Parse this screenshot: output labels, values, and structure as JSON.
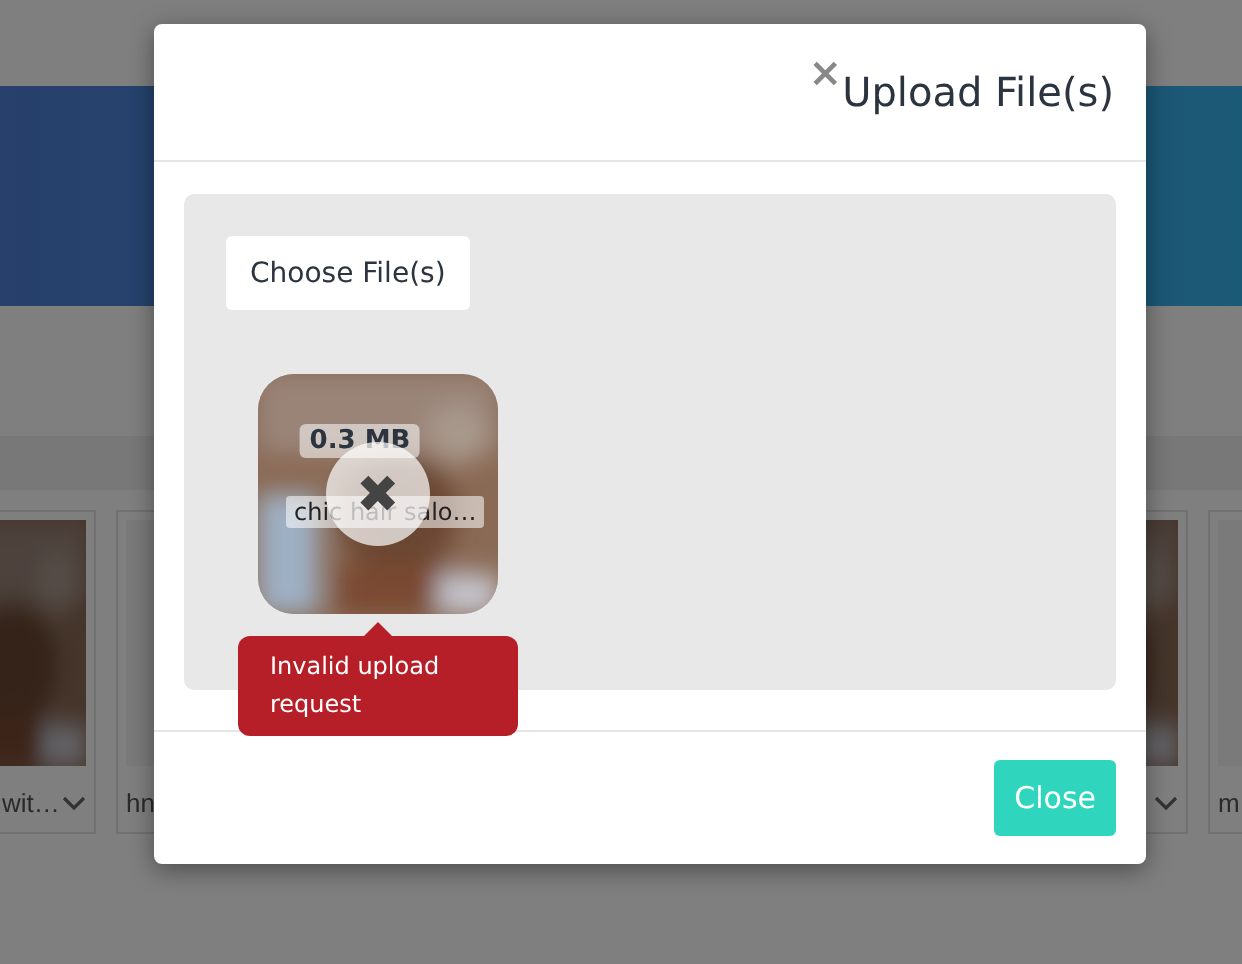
{
  "background_page": {
    "cards": [
      {
        "kind": "picture",
        "caption": "wit…",
        "has_menu": true
      },
      {
        "kind": "blank",
        "caption": "hn"
      },
      {
        "kind": "picture",
        "has_menu": true
      },
      {
        "kind": "blank",
        "caption": "m"
      }
    ]
  },
  "dialog": {
    "close_icon": "×",
    "title": "Upload File(s)",
    "choose_button": "Choose File(s)",
    "files": [
      {
        "size": "0.3 MB",
        "name": "chic hair salo…",
        "remove_icon": "✖",
        "error": "Invalid upload request"
      }
    ],
    "footer_button": "Close"
  }
}
